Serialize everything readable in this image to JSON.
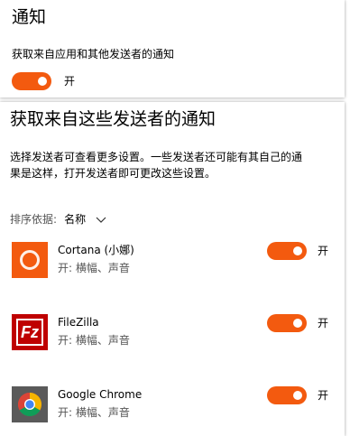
{
  "colors": {
    "accent": "#f35a0f",
    "cortana_bg": "#f35a0f",
    "filezilla_bg": "#bf0000",
    "chrome_bg": "#5a5a5a"
  },
  "top": {
    "title": "通知",
    "description": "获取来自应用和其他发送者的通知",
    "toggle_label": "开"
  },
  "main": {
    "title": "获取来自这些发送者的通知",
    "description_line1": "选择发送者可查看更多设置。一些发送者还可能有其自己的通",
    "description_line2": "果是这样，打开发送者即可更改这些设置。",
    "sort_label": "排序依据:",
    "sort_value": "名称",
    "apps": [
      {
        "name": "Cortana (小娜)",
        "status": "开: 横幅、声音",
        "toggle_label": "开",
        "icon": "cortana-icon"
      },
      {
        "name": "FileZilla",
        "status": "开: 横幅、声音",
        "toggle_label": "开",
        "icon": "filezilla-icon"
      },
      {
        "name": "Google Chrome",
        "status": "开: 横幅、声音",
        "toggle_label": "开",
        "icon": "chrome-icon"
      }
    ]
  }
}
